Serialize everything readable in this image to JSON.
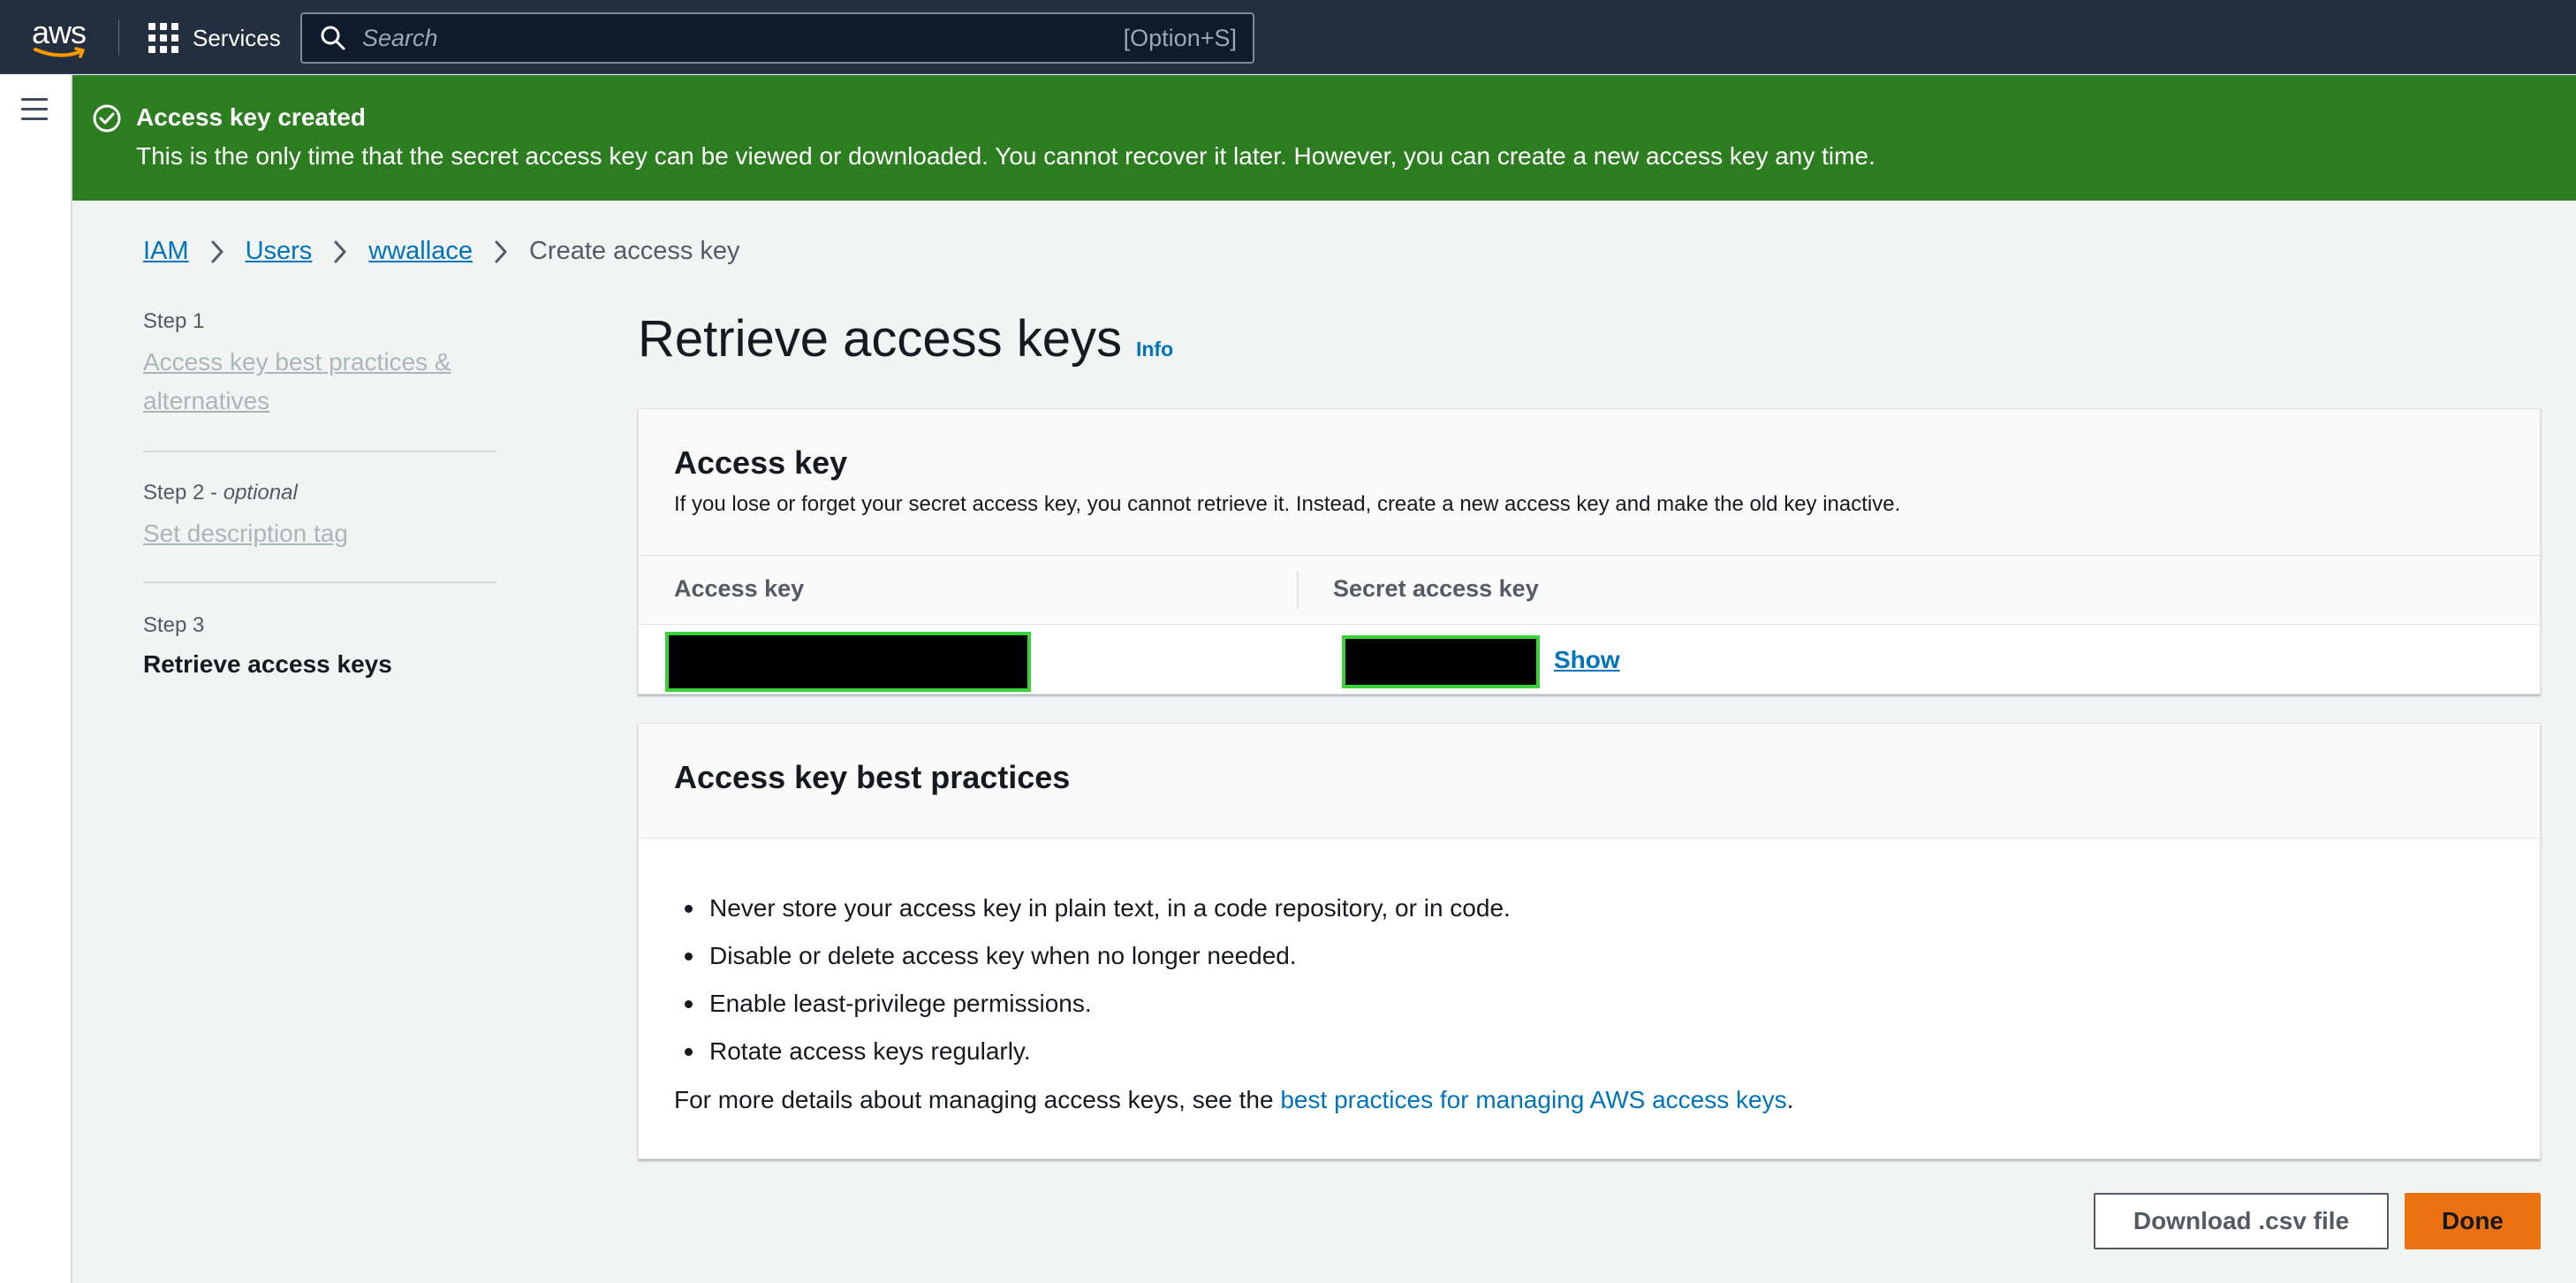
{
  "topnav": {
    "logo_text": "aws",
    "services_label": "Services",
    "search_placeholder": "Search",
    "search_shortcut": "[Option+S]"
  },
  "flash": {
    "title": "Access key created",
    "message": "This is the only time that the secret access key can be viewed or downloaded. You cannot recover it later. However, you can create a new access key any time.",
    "color": "#2c7d1f"
  },
  "breadcrumb": {
    "items": [
      "IAM",
      "Users",
      "wwallace"
    ],
    "current": "Create access key"
  },
  "steps": [
    {
      "label": "Step 1",
      "name": "Access key best practices & alternatives"
    },
    {
      "label": "Step 2",
      "optional": "optional",
      "name": "Set description tag"
    },
    {
      "label": "Step 3",
      "name": "Retrieve access keys"
    }
  ],
  "main": {
    "title": "Retrieve access keys",
    "info": "Info"
  },
  "access_key_panel": {
    "title": "Access key",
    "description": "If you lose or forget your secret access key, you cannot retrieve it. Instead, create a new access key and make the old key inactive.",
    "columns": [
      "Access key",
      "Secret access key"
    ],
    "show_label": "Show"
  },
  "best_practices": {
    "title": "Access key best practices",
    "items": [
      "Never store your access key in plain text, in a code repository, or in code.",
      "Disable or delete access key when no longer needed.",
      "Enable least-privilege permissions.",
      "Rotate access keys regularly."
    ],
    "more_prefix": "For more details about managing access keys, see the ",
    "more_link": "best practices for managing AWS access keys",
    "more_suffix": "."
  },
  "actions": {
    "download_label": "Download .csv file",
    "done_label": "Done"
  },
  "colors": {
    "nav_bg": "#232f3e",
    "link": "#0073bb",
    "primary": "#ec7211",
    "redaction_border": "#3ad13a"
  }
}
